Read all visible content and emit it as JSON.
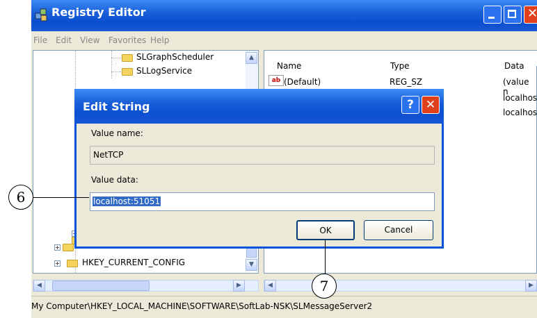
{
  "window": {
    "title": "Registry Editor",
    "menu": [
      "File",
      "Edit",
      "View",
      "Favorites",
      "Help"
    ]
  },
  "tree": {
    "items": [
      {
        "label": "SLGraphScheduler"
      },
      {
        "label": "SLLogService"
      },
      {
        "label": "HKEY_CURRENT_CONFIG"
      }
    ]
  },
  "list": {
    "columns": [
      "Name",
      "Type",
      "Data"
    ],
    "rows": [
      {
        "name": "(Default)",
        "type": "REG_SZ",
        "data": "(value n"
      },
      {
        "name": "",
        "type": "",
        "data": "localhos"
      },
      {
        "name": "",
        "type": "",
        "data": "localhos"
      }
    ]
  },
  "status": {
    "path": "My Computer\\HKEY_LOCAL_MACHINE\\SOFTWARE\\SoftLab-NSK\\SLMessageServer2"
  },
  "dialog": {
    "title": "Edit String",
    "value_name_label": "Value name:",
    "value_name": "NetTCP",
    "value_data_label": "Value data:",
    "value_data": "localhost:51051",
    "ok_label": "OK",
    "cancel_label": "Cancel",
    "help_glyph": "?"
  },
  "callouts": {
    "one": "6",
    "two": "7"
  },
  "colors": {
    "title_blue": "#0b4fd0",
    "close_red": "#e0411a",
    "selection": "#316ac5"
  }
}
